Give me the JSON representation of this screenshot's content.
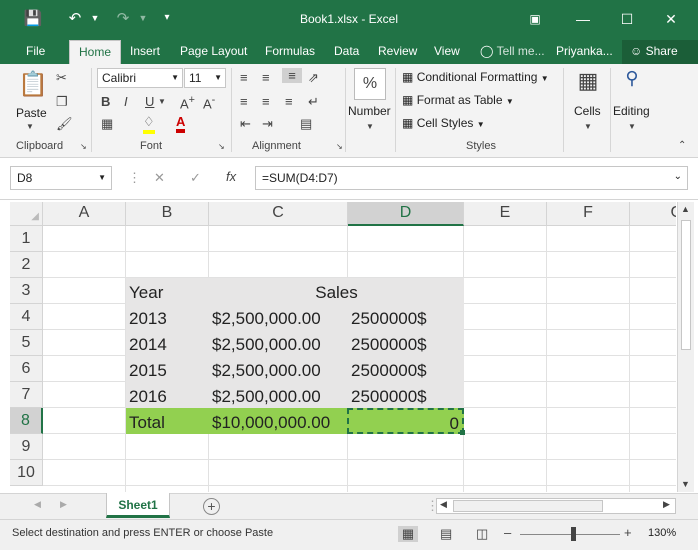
{
  "titlebar": {
    "title": "Book1.xlsx - Excel",
    "save_icon": "save-icon",
    "undo_icon": "undo-icon",
    "redo_icon": "redo-icon"
  },
  "menu": {
    "tabs": [
      "File",
      "Home",
      "Insert",
      "Page Layout",
      "Formulas",
      "Data",
      "Review",
      "View"
    ],
    "tell_me": "Tell me...",
    "user": "Priyanka...",
    "share": "Share"
  },
  "ribbon": {
    "clipboard": {
      "label": "Clipboard",
      "paste": "Paste"
    },
    "font": {
      "label": "Font",
      "family": "Calibri",
      "size": "11"
    },
    "alignment": {
      "label": "Alignment"
    },
    "number": {
      "label": "Number",
      "symbol": "%"
    },
    "styles": {
      "label": "Styles",
      "conditional": "Conditional Formatting",
      "format_table": "Format as Table",
      "cell_styles": "Cell Styles"
    },
    "cells": {
      "label": "Cells"
    },
    "editing": {
      "label": "Editing"
    }
  },
  "formula_bar": {
    "name_box": "D8",
    "formula": "=SUM(D4:D7)",
    "fx": "fx"
  },
  "columns": [
    "A",
    "B",
    "C",
    "D",
    "E",
    "F",
    "G"
  ],
  "rows": [
    "1",
    "2",
    "3",
    "4",
    "5",
    "6",
    "7",
    "8",
    "9",
    "10"
  ],
  "cells": {
    "B3": "Year",
    "C3": "Sales",
    "B4": "2013",
    "C4": "$2,500,000.00",
    "D4": "2500000$",
    "B5": "2014",
    "C5": "$2,500,000.00",
    "D5": "2500000$",
    "B6": "2015",
    "C6": "$2,500,000.00",
    "D6": "2500000$",
    "B7": "2016",
    "C7": "$2,500,000.00",
    "D7": "2500000$",
    "B8": "Total",
    "C8": "$10,000,000.00",
    "D8": "0"
  },
  "sheet_tabs": {
    "active": "Sheet1",
    "add": "+"
  },
  "status": {
    "message": "Select destination and press ENTER or choose Paste",
    "zoom": "130%"
  },
  "colors": {
    "excel_green": "#217346",
    "fill_gray": "#e7e6e6",
    "fill_green": "#92d050"
  }
}
